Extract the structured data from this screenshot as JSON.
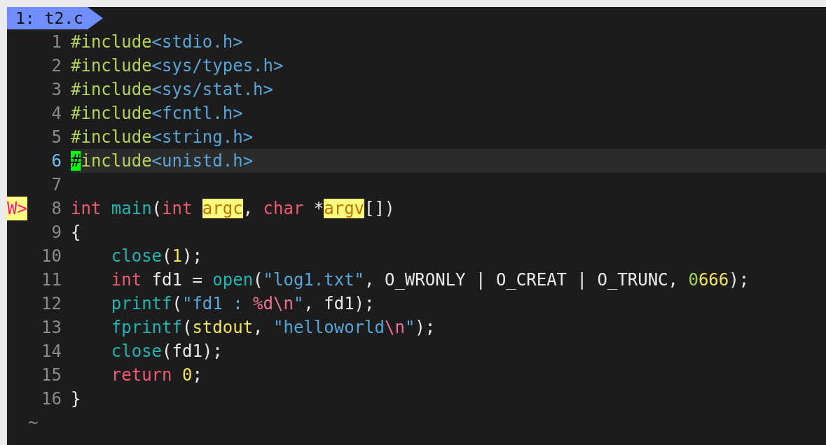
{
  "tabline": {
    "tab": {
      "label": "1: t2.c",
      "selected": true
    }
  },
  "lines": [
    {
      "number": "1",
      "selected": false,
      "tokens": [
        {
          "text": "#include",
          "kind": "preproc"
        },
        {
          "text": "<stdio.h>",
          "kind": "path"
        }
      ]
    },
    {
      "number": "2",
      "selected": false,
      "tokens": [
        {
          "text": "#include",
          "kind": "preproc"
        },
        {
          "text": "<sys/types.h>",
          "kind": "path"
        }
      ]
    },
    {
      "number": "3",
      "selected": false,
      "tokens": [
        {
          "text": "#include",
          "kind": "preproc"
        },
        {
          "text": "<sys/stat.h>",
          "kind": "path"
        }
      ]
    },
    {
      "number": "4",
      "selected": false,
      "tokens": [
        {
          "text": "#include",
          "kind": "preproc"
        },
        {
          "text": "<fcntl.h>",
          "kind": "path"
        }
      ]
    },
    {
      "number": "5",
      "selected": false,
      "tokens": [
        {
          "text": "#include",
          "kind": "preproc"
        },
        {
          "text": "<string.h>",
          "kind": "path"
        }
      ]
    },
    {
      "number": "6",
      "selected": true,
      "tokens": [
        {
          "text": "#",
          "kind": "cursor"
        },
        {
          "text": "include",
          "kind": "preproc"
        },
        {
          "text": "<unistd.h>",
          "kind": "path"
        }
      ]
    },
    {
      "number": "7",
      "selected": false
    },
    {
      "number": "8",
      "selected": false,
      "sign": "W>",
      "tokens": [
        {
          "text": "int",
          "kind": "keyword"
        },
        {
          "text": " main",
          "kind": "function"
        },
        {
          "text": "(",
          "kind": "plain"
        },
        {
          "text": "int ",
          "kind": "keyword"
        },
        {
          "text": "argc",
          "kind": "warning"
        },
        {
          "text": ", ",
          "kind": "plain"
        },
        {
          "text": "char",
          "kind": "keyword"
        },
        {
          "text": " *",
          "kind": "plain"
        },
        {
          "text": "argv",
          "kind": "warning"
        },
        {
          "text": "[])",
          "kind": "plain"
        }
      ]
    },
    {
      "number": "9",
      "selected": false,
      "tokens": [
        {
          "text": "{",
          "kind": "plain"
        }
      ]
    },
    {
      "number": "10",
      "selected": false,
      "indented": true,
      "tokens": [
        {
          "text": "close",
          "kind": "function"
        },
        {
          "text": "(",
          "kind": "plain"
        },
        {
          "text": "1",
          "kind": "number"
        },
        {
          "text": ");",
          "kind": "plain"
        }
      ]
    },
    {
      "number": "11",
      "selected": false,
      "indented": true,
      "tokens": [
        {
          "text": "int",
          "kind": "keyword"
        },
        {
          "text": " fd1 = ",
          "kind": "plain"
        },
        {
          "text": "open",
          "kind": "function"
        },
        {
          "text": "(",
          "kind": "plain"
        },
        {
          "text": "\"log1.txt\"",
          "kind": "string"
        },
        {
          "text": ", O_WRONLY | O_CREAT | O_TRUNC, ",
          "kind": "plain"
        },
        {
          "text": "0",
          "kind": "octal"
        },
        {
          "text": "666",
          "kind": "number"
        },
        {
          "text": ");",
          "kind": "plain"
        }
      ]
    },
    {
      "number": "12",
      "selected": false,
      "indented": true,
      "tokens": [
        {
          "text": "printf",
          "kind": "function"
        },
        {
          "text": "(",
          "kind": "plain"
        },
        {
          "text": "\"fd1 : ",
          "kind": "string"
        },
        {
          "text": "%d\\n",
          "kind": "escape"
        },
        {
          "text": "\"",
          "kind": "string"
        },
        {
          "text": ", fd1);",
          "kind": "plain"
        }
      ]
    },
    {
      "number": "13",
      "selected": false,
      "indented": true,
      "tokens": [
        {
          "text": "fprintf",
          "kind": "function"
        },
        {
          "text": "(",
          "kind": "plain"
        },
        {
          "text": "stdout",
          "kind": "constant"
        },
        {
          "text": ", ",
          "kind": "plain"
        },
        {
          "text": "\"helloworld",
          "kind": "string"
        },
        {
          "text": "\\n",
          "kind": "escape"
        },
        {
          "text": "\"",
          "kind": "string"
        },
        {
          "text": ");",
          "kind": "plain"
        }
      ]
    },
    {
      "number": "14",
      "selected": false,
      "indented": true,
      "tokens": [
        {
          "text": "close",
          "kind": "function"
        },
        {
          "text": "(fd1);",
          "kind": "plain"
        }
      ]
    },
    {
      "number": "15",
      "selected": false,
      "indented": true,
      "tokens": [
        {
          "text": "return ",
          "kind": "keyword"
        },
        {
          "text": "0",
          "kind": "number"
        },
        {
          "text": ";",
          "kind": "plain"
        }
      ]
    },
    {
      "number": "16",
      "selected": false,
      "tokens": [
        {
          "text": "}",
          "kind": "plain"
        }
      ]
    }
  ],
  "filler": [
    "~"
  ]
}
